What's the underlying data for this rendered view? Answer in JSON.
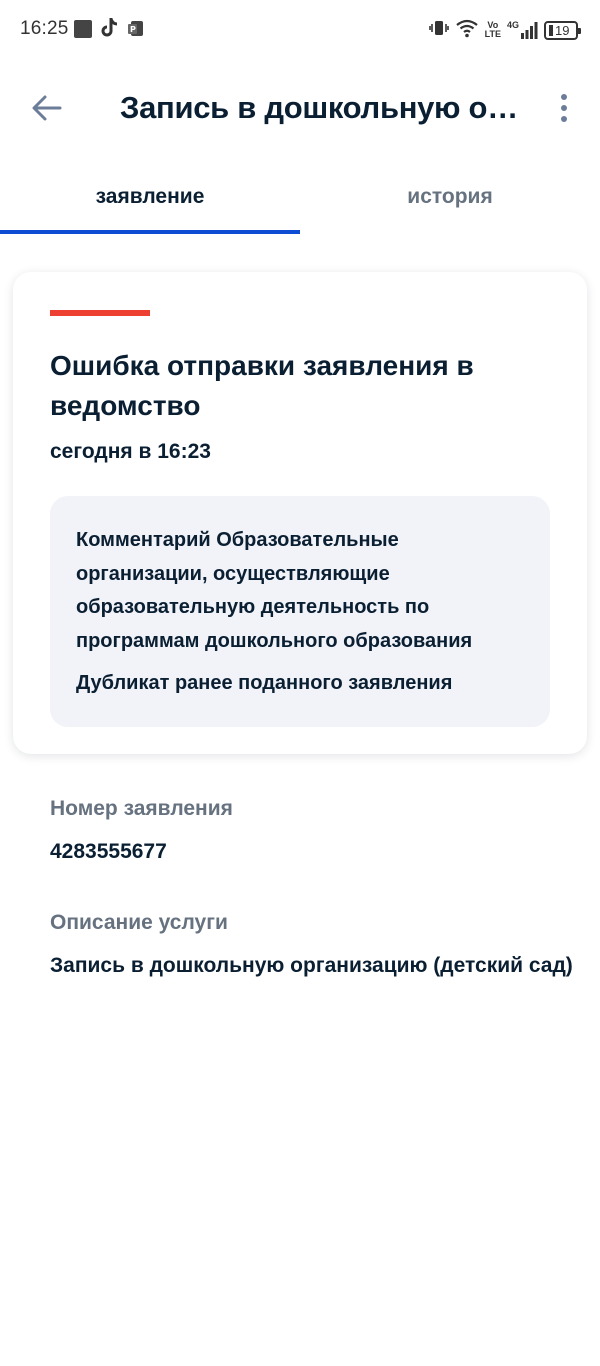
{
  "status_bar": {
    "time": "16:25",
    "network_volte": "Vo\nLTE",
    "network_gen": "4G",
    "battery": "19"
  },
  "header": {
    "title": "Запись в дошкольную организацию (детский сад)",
    "back_icon": "arrow-left-icon",
    "menu_icon": "more-vertical-icon"
  },
  "tabs": [
    {
      "label": "заявление",
      "active": true
    },
    {
      "label": "история",
      "active": false
    }
  ],
  "status_card": {
    "accent_color": "#ee3f33",
    "title": "Ошибка отправки заявления в ведомство",
    "date": "сегодня в 16:23",
    "comment": "Комментарий Образовательные организации, осуществляющие образовательную деятельность по программам дошкольного образования",
    "comment_extra": "Дубликат ранее поданного заявления"
  },
  "details": {
    "number_label": "Номер заявления",
    "number_value": "4283555677",
    "service_label": "Описание услуги",
    "service_value": "Запись в дошкольную организацию (детский сад)"
  },
  "colors": {
    "accent_blue": "#0d4cd3",
    "error_red": "#ee3f33",
    "text_primary": "#0b1f33",
    "text_secondary": "#66727f"
  }
}
